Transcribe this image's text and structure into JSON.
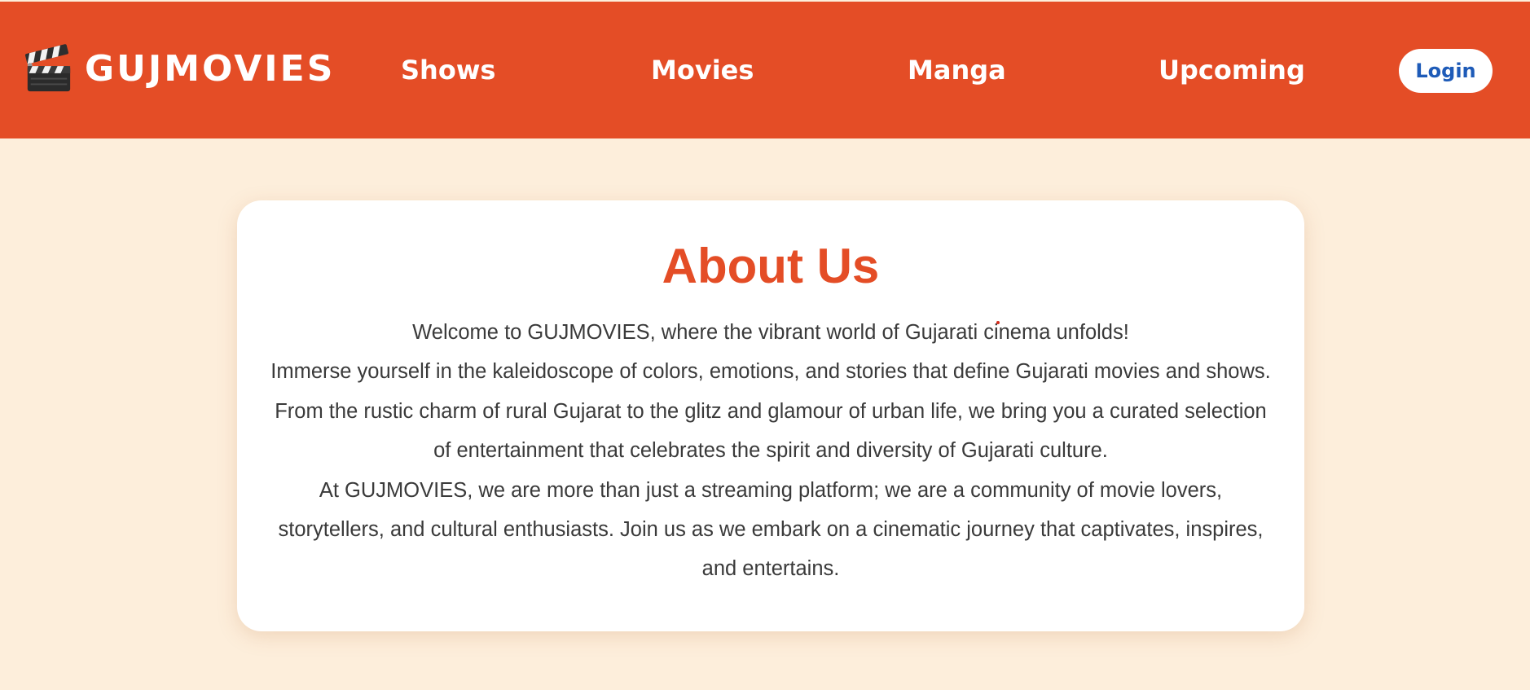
{
  "header": {
    "brand_name": "GUJMOVIES",
    "brand_icon": "clapperboard-icon",
    "nav": [
      {
        "label": "Shows"
      },
      {
        "label": "Movies"
      },
      {
        "label": "Manga"
      },
      {
        "label": "Upcoming"
      }
    ],
    "login_label": "Login"
  },
  "about": {
    "title": "About Us",
    "paragraphs": [
      "Welcome to GUJMOVIES, where the vibrant world of Gujarati cinema unfolds!",
      "Immerse yourself in the kaleidoscope of colors, emotions, and stories that define Gujarati movies and shows. From the rustic charm of rural Gujarat to the glitz and glamour of urban life, we bring you a curated selection of entertainment that celebrates the spirit and diversity of Gujarati culture.",
      "At GUJMOVIES, we are more than just a streaming platform; we are a community of movie lovers, storytellers, and cultural enthusiasts. Join us as we embark on a cinematic journey that captivates, inspires, and entertains."
    ]
  },
  "colors": {
    "header_bg": "#e44d26",
    "page_bg": "#fdeedb",
    "card_bg": "#ffffff",
    "title": "#e44d26",
    "body_text": "#3a3a3a",
    "login_text": "#1e5bb8"
  }
}
